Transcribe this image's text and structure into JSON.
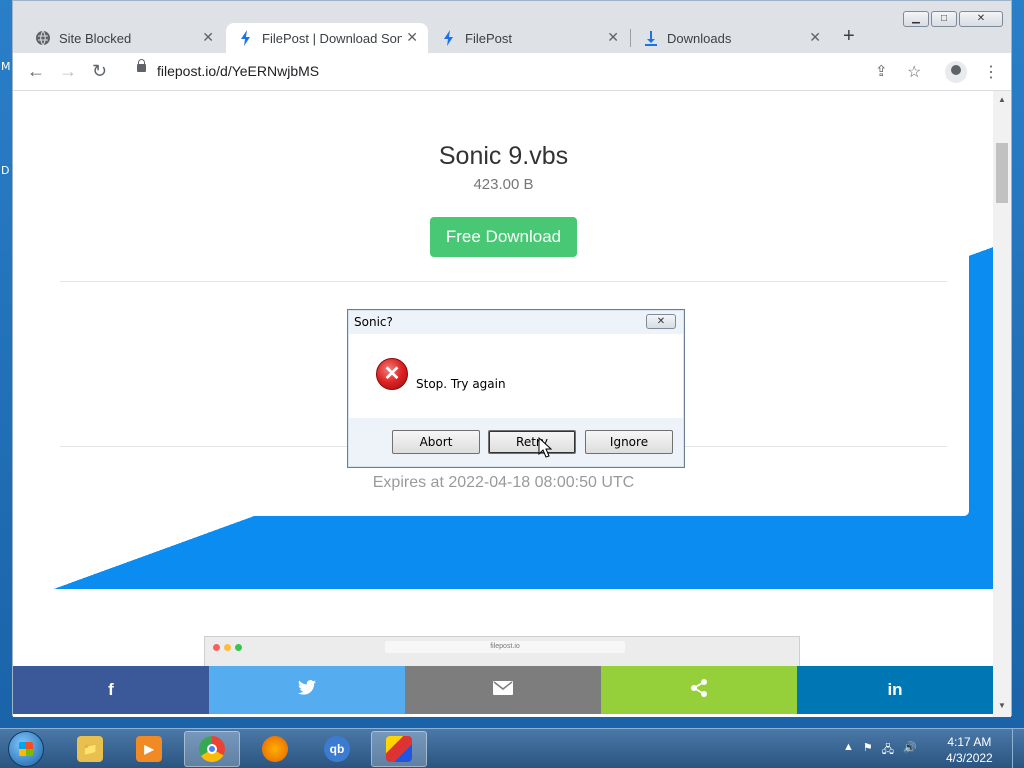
{
  "desktop": {
    "edge_letters": [
      "M",
      "D"
    ]
  },
  "browser": {
    "tabs": [
      {
        "title": "Site Blocked",
        "icon": "globe-icon"
      },
      {
        "title": "FilePost | Download Sonic",
        "icon": "bolt-icon"
      },
      {
        "title": "FilePost",
        "icon": "bolt-icon"
      },
      {
        "title": "Downloads",
        "icon": "download-icon"
      }
    ],
    "new_tab": "+",
    "window_controls": {
      "minimize": "▁",
      "maximize": "□",
      "close": "✕"
    },
    "url": "filepost.io/d/YeERNwjbMS"
  },
  "page": {
    "file_name": "Sonic 9.vbs",
    "file_size": "423.00 B",
    "download_label": "Free Download",
    "expires": "Expires at 2022-04-18 08:00:50 UTC",
    "preview_url": "filepost.io",
    "share": [
      {
        "name": "facebook",
        "glyph": "f",
        "color": "#3b5998"
      },
      {
        "name": "twitter",
        "glyph": "🐦",
        "color": "#55acee"
      },
      {
        "name": "email",
        "glyph": "✉",
        "color": "#7d7d7d"
      },
      {
        "name": "sharethis",
        "glyph": "⋖",
        "color": "#95d03a"
      },
      {
        "name": "linkedin",
        "glyph": "in",
        "color": "#0077b5"
      }
    ]
  },
  "dialog": {
    "title": "Sonic?",
    "message": "Stop. Try again",
    "buttons": [
      "Abort",
      "Retry",
      "Ignore"
    ],
    "close": "✕"
  },
  "taskbar": {
    "apps": [
      {
        "name": "explorer",
        "label": "📁",
        "color": "#e8c050"
      },
      {
        "name": "media-player",
        "label": "▶",
        "color": "#f08a24"
      },
      {
        "name": "chrome",
        "label": "◉",
        "color": "#4caf50"
      },
      {
        "name": "firefox",
        "label": "🦊",
        "color": "#e66000"
      },
      {
        "name": "qbittorrent",
        "label": "qb",
        "color": "#3b7bd1"
      },
      {
        "name": "sonic-app",
        "label": "▲",
        "color": "#d33"
      }
    ],
    "time": "4:17 AM",
    "date": "4/3/2022"
  }
}
